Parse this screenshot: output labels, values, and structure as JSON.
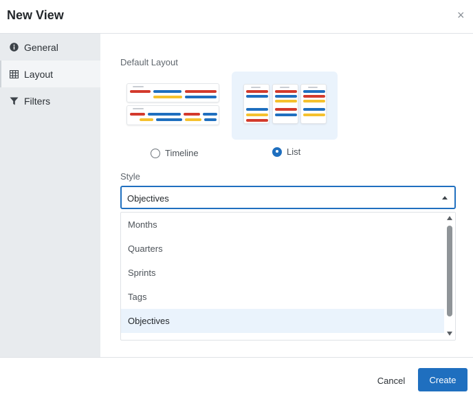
{
  "dialog": {
    "title": "New View",
    "close_icon": "close-icon",
    "close_glyph": "×"
  },
  "sidebar": {
    "items": [
      {
        "label": "General",
        "icon": "info-icon",
        "active": false
      },
      {
        "label": "Layout",
        "icon": "grid-icon",
        "active": true
      },
      {
        "label": "Filters",
        "icon": "filter-icon",
        "active": false
      }
    ]
  },
  "layout": {
    "section_label": "Default Layout",
    "options": [
      {
        "label": "Timeline",
        "selected": false
      },
      {
        "label": "List",
        "selected": true
      }
    ]
  },
  "style": {
    "section_label": "Style",
    "selected_value": "Objectives",
    "options": [
      "Months",
      "Quarters",
      "Sprints",
      "Tags",
      "Objectives"
    ],
    "highlighted_option": "Objectives"
  },
  "footer": {
    "cancel_label": "Cancel",
    "create_label": "Create"
  },
  "colors": {
    "accent": "#1f6fbf",
    "bar_red": "#d33a2c",
    "bar_blue": "#1f6fbf",
    "bar_yellow": "#f5c12e",
    "selected_card_bg": "#eaf3fc",
    "sidebar_bg": "#e8ebee"
  }
}
